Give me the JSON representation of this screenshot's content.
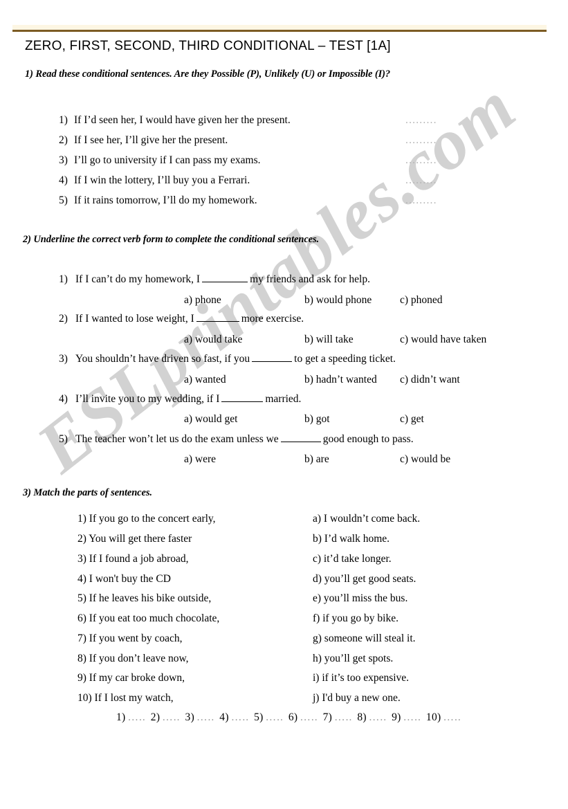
{
  "document": {
    "title": "ZERO, FIRST, SECOND, THIRD CONDITIONAL – TEST [1A]",
    "watermark": "ESLprintables.com",
    "rule_color": "#7c5c24"
  },
  "exercise1": {
    "heading": "1) Read these conditional sentences. Are they Possible (P), Unlikely (U) or Impossible (I)?",
    "blank": ".........",
    "items": [
      {
        "num": "1)",
        "text": "If I’d seen her, I would have given her the present."
      },
      {
        "num": "2)",
        "text": "If I see her, I’ll give her the present."
      },
      {
        "num": "3)",
        "text": "I’ll go to university if I can pass my exams."
      },
      {
        "num": "4)",
        "text": "If I win the lottery, I’ll buy you a Ferrari."
      },
      {
        "num": "5)",
        "text": "If it rains tomorrow, I’ll do my homework."
      }
    ]
  },
  "exercise2": {
    "heading": "2) Underline the correct verb form to complete the conditional sentences.",
    "items": [
      {
        "num": "1)",
        "before": "If I can’t do my homework, I",
        "after": "my friends and ask for help.",
        "options": {
          "a": "a) phone",
          "b": "b) would phone",
          "c": "c) phoned"
        }
      },
      {
        "num": "2)",
        "before": "If I wanted to lose weight, I",
        "after": "more exercise.",
        "options": {
          "a": "a) would take",
          "b": "b) will take",
          "c": "c) would have taken"
        }
      },
      {
        "num": "3)",
        "before": "You shouldn’t have driven so fast, if you",
        "after": "to get a speeding ticket.",
        "options": {
          "a": "a) wanted",
          "b": "b) hadn’t wanted",
          "c": "c) didn’t want"
        }
      },
      {
        "num": "4)",
        "before": "I’ll invite you to my wedding, if I",
        "after": "married.",
        "options": {
          "a": "a) would get",
          "b": "b) got",
          "c": "c) get"
        }
      },
      {
        "num": "5)",
        "before": "The teacher won’t let us do the exam unless we",
        "after": "good enough to pass.",
        "options": {
          "a": "a) were",
          "b": "b) are",
          "c": "c) would be"
        }
      }
    ]
  },
  "exercise3": {
    "heading": "3) Match the parts of sentences.",
    "left": [
      "1) If you go to the concert early,",
      "2) You will get there faster",
      "3) If I found a job abroad,",
      "4) I won't buy the CD",
      "5) If he leaves his bike outside,",
      "6) If you eat too much chocolate,",
      "7) If you went by coach,",
      "8) If you don’t leave now,",
      "9) If my car broke down,",
      "10) If I lost my watch,"
    ],
    "right": [
      "a) I wouldn’t come back.",
      "b) I’d walk home.",
      "c) it’d take longer.",
      "d) you’ll get good seats.",
      "e) you’ll miss the bus.",
      "f) if you go by bike.",
      "g) someone will steal it.",
      "h) you’ll get spots.",
      "i) if it’s too expensive.",
      "j) I'd buy a new one."
    ],
    "answer_slots": [
      "1)",
      "2)",
      "3)",
      "4)",
      "5)",
      "6)",
      "7)",
      "8)",
      "9)",
      "10)"
    ],
    "answer_dots": "….."
  }
}
